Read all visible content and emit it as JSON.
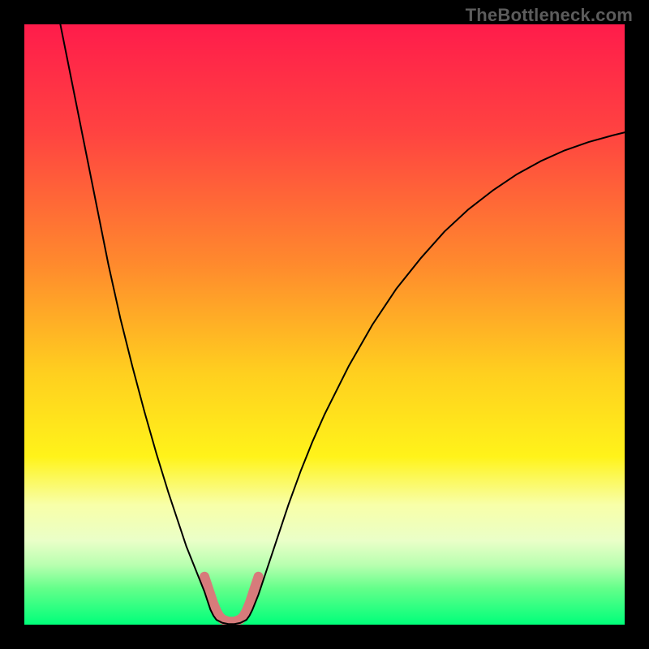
{
  "watermark": "TheBottleneck.com",
  "chart_data": {
    "type": "line",
    "title": "",
    "xlabel": "",
    "ylabel": "",
    "xlim": [
      0,
      100
    ],
    "ylim": [
      0,
      100
    ],
    "gradient_stops": [
      {
        "offset": 0,
        "color": "#ff1c4b"
      },
      {
        "offset": 18,
        "color": "#ff4341"
      },
      {
        "offset": 40,
        "color": "#ff8a2d"
      },
      {
        "offset": 58,
        "color": "#ffcf1f"
      },
      {
        "offset": 72,
        "color": "#fff31a"
      },
      {
        "offset": 80,
        "color": "#f8ffa8"
      },
      {
        "offset": 86,
        "color": "#eaffc8"
      },
      {
        "offset": 90,
        "color": "#b9ffb0"
      },
      {
        "offset": 94,
        "color": "#63ff8a"
      },
      {
        "offset": 100,
        "color": "#00ff7a"
      }
    ],
    "series": [
      {
        "name": "curve",
        "stroke": "#000000",
        "stroke_width": 2,
        "points": [
          {
            "x": 6.0,
            "y": 100.0
          },
          {
            "x": 8.0,
            "y": 90.0
          },
          {
            "x": 10.0,
            "y": 80.0
          },
          {
            "x": 12.0,
            "y": 70.0
          },
          {
            "x": 14.0,
            "y": 60.0
          },
          {
            "x": 16.0,
            "y": 51.0
          },
          {
            "x": 18.0,
            "y": 43.0
          },
          {
            "x": 20.0,
            "y": 35.5
          },
          {
            "x": 22.0,
            "y": 28.5
          },
          {
            "x": 24.0,
            "y": 22.0
          },
          {
            "x": 26.0,
            "y": 16.0
          },
          {
            "x": 27.0,
            "y": 13.0
          },
          {
            "x": 28.0,
            "y": 10.5
          },
          {
            "x": 29.0,
            "y": 8.0
          },
          {
            "x": 30.0,
            "y": 5.5
          },
          {
            "x": 30.5,
            "y": 4.0
          },
          {
            "x": 31.0,
            "y": 2.5
          },
          {
            "x": 31.5,
            "y": 1.5
          },
          {
            "x": 32.0,
            "y": 0.8
          },
          {
            "x": 33.0,
            "y": 0.3
          },
          {
            "x": 34.0,
            "y": 0.1
          },
          {
            "x": 35.0,
            "y": 0.1
          },
          {
            "x": 36.0,
            "y": 0.3
          },
          {
            "x": 37.0,
            "y": 0.8
          },
          {
            "x": 37.5,
            "y": 1.5
          },
          {
            "x": 38.0,
            "y": 2.5
          },
          {
            "x": 39.0,
            "y": 5.0
          },
          {
            "x": 40.0,
            "y": 8.0
          },
          {
            "x": 42.0,
            "y": 14.0
          },
          {
            "x": 44.0,
            "y": 20.0
          },
          {
            "x": 46.0,
            "y": 25.5
          },
          {
            "x": 48.0,
            "y": 30.5
          },
          {
            "x": 50.0,
            "y": 35.0
          },
          {
            "x": 54.0,
            "y": 43.0
          },
          {
            "x": 58.0,
            "y": 50.0
          },
          {
            "x": 62.0,
            "y": 56.0
          },
          {
            "x": 66.0,
            "y": 61.0
          },
          {
            "x": 70.0,
            "y": 65.5
          },
          {
            "x": 74.0,
            "y": 69.2
          },
          {
            "x": 78.0,
            "y": 72.3
          },
          {
            "x": 82.0,
            "y": 75.0
          },
          {
            "x": 86.0,
            "y": 77.2
          },
          {
            "x": 90.0,
            "y": 79.0
          },
          {
            "x": 94.0,
            "y": 80.4
          },
          {
            "x": 98.0,
            "y": 81.5
          },
          {
            "x": 100.0,
            "y": 82.0
          }
        ]
      },
      {
        "name": "highlight-band",
        "stroke": "#d77b7b",
        "stroke_width": 12,
        "points": [
          {
            "x": 30.0,
            "y": 8.0
          },
          {
            "x": 30.5,
            "y": 6.5
          },
          {
            "x": 31.0,
            "y": 5.0
          },
          {
            "x": 31.5,
            "y": 3.5
          },
          {
            "x": 32.0,
            "y": 2.3
          },
          {
            "x": 32.5,
            "y": 1.4
          },
          {
            "x": 33.0,
            "y": 0.9
          },
          {
            "x": 34.0,
            "y": 0.5
          },
          {
            "x": 35.0,
            "y": 0.5
          },
          {
            "x": 36.0,
            "y": 0.9
          },
          {
            "x": 36.5,
            "y": 1.4
          },
          {
            "x": 37.0,
            "y": 2.3
          },
          {
            "x": 37.5,
            "y": 3.5
          },
          {
            "x": 38.0,
            "y": 5.0
          },
          {
            "x": 38.5,
            "y": 6.5
          },
          {
            "x": 39.0,
            "y": 8.0
          }
        ]
      }
    ]
  }
}
